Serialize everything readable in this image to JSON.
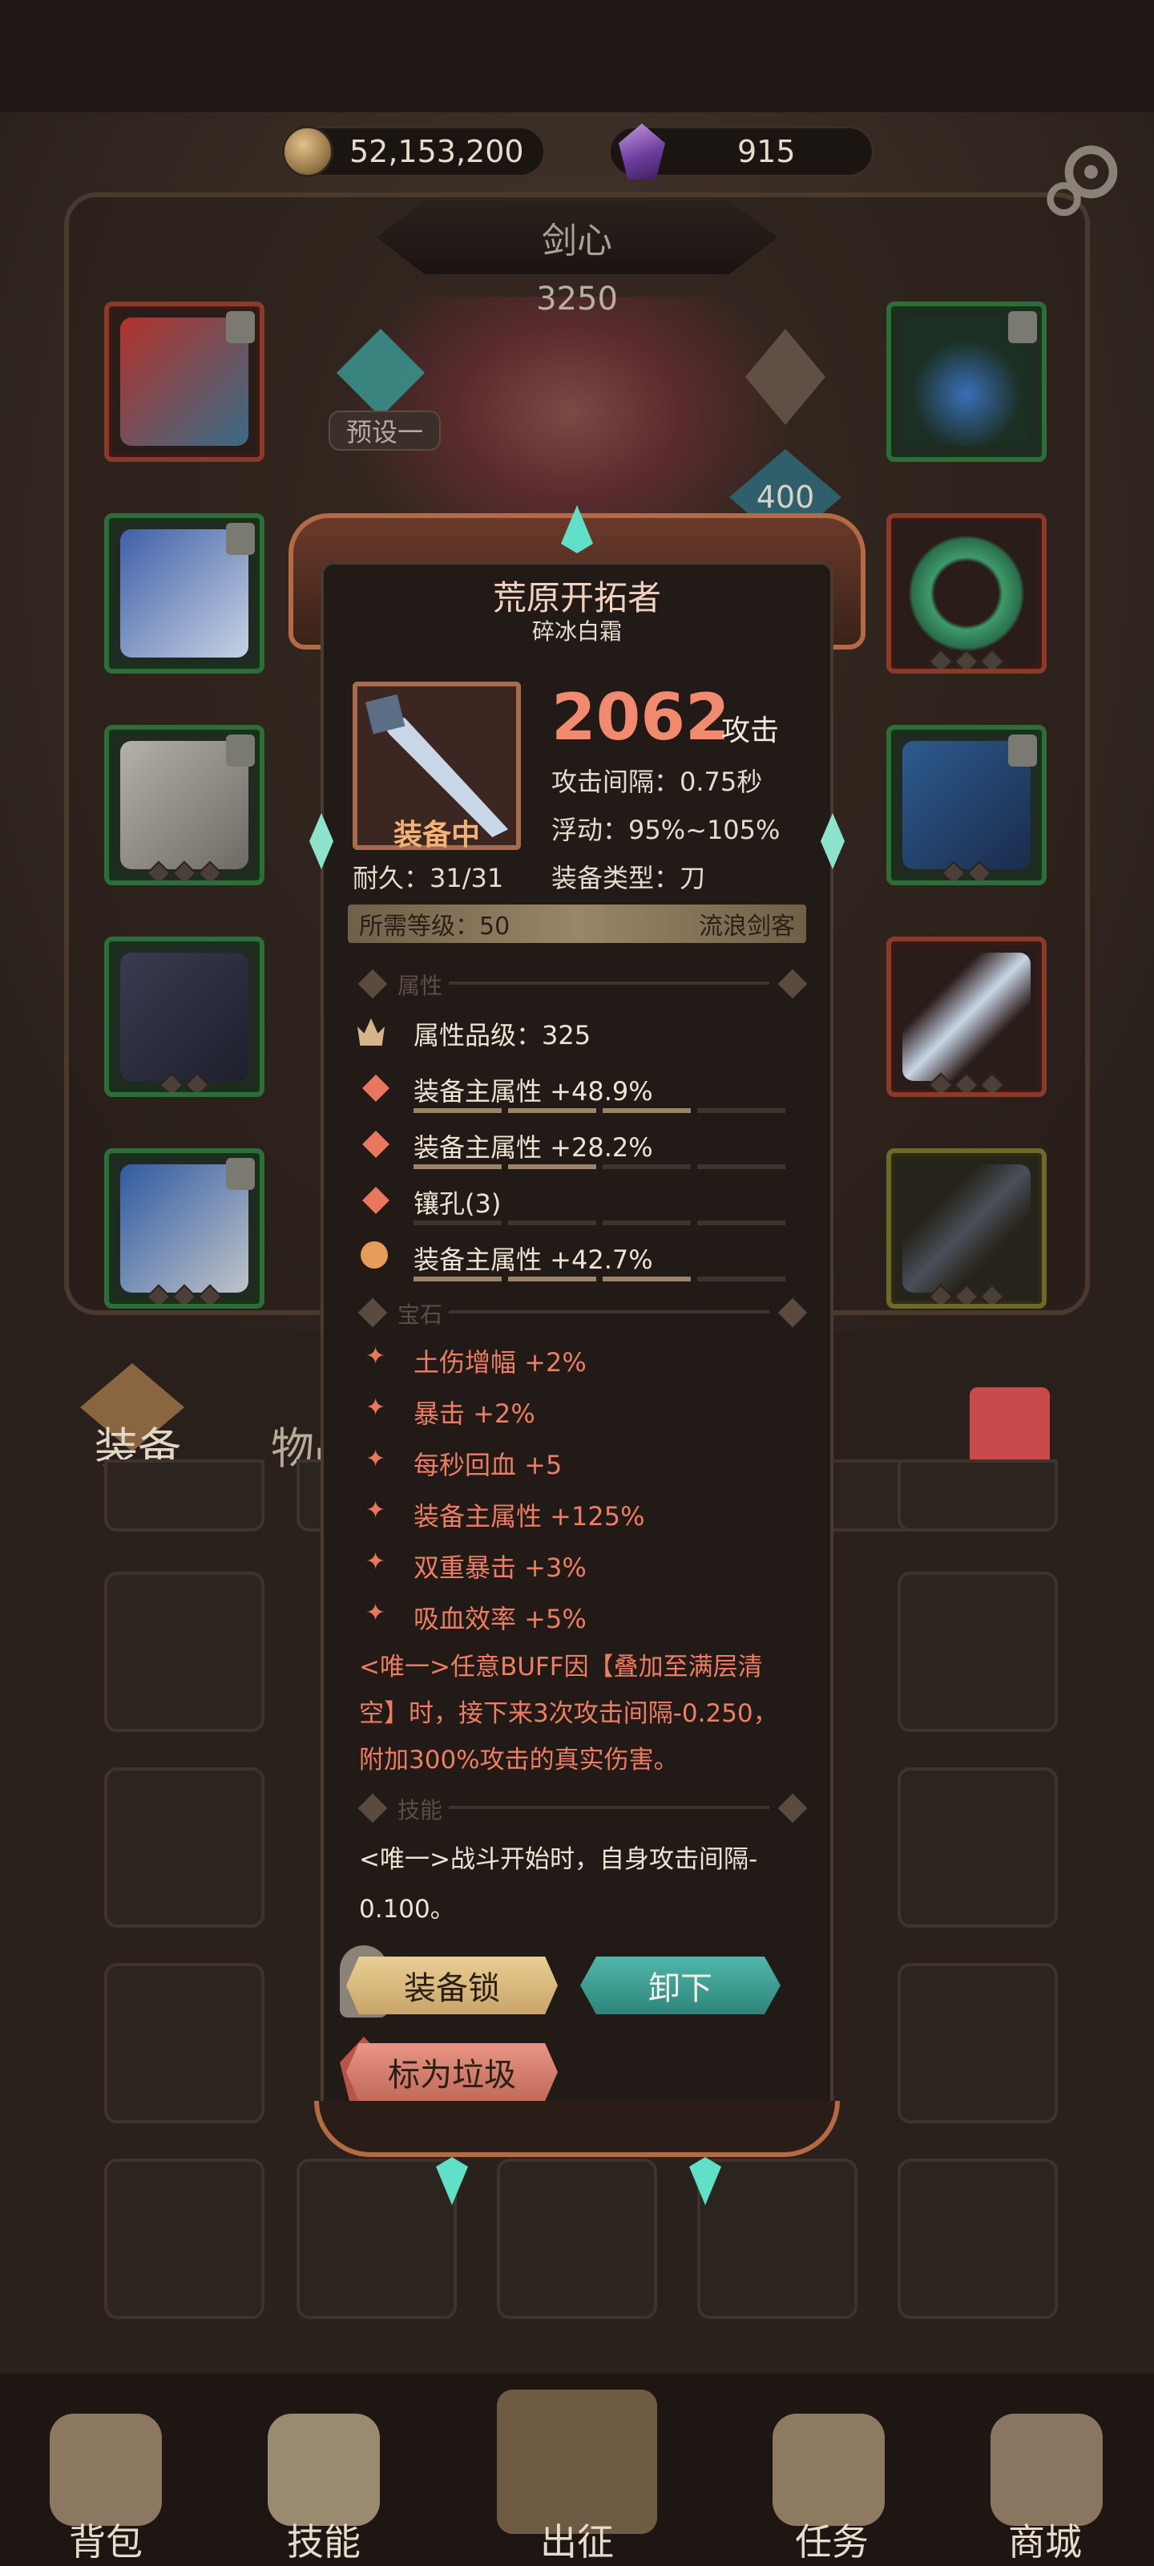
{
  "currency": {
    "gold": "52,153,200",
    "gems": "915",
    "gold_icon": "coin-icon",
    "gem_icon": "purple-gem-icon"
  },
  "settings_icon": "gear-icon",
  "hero": {
    "name": "剑心",
    "score": "3250",
    "preset_label": "预设一",
    "level": "400"
  },
  "item": {
    "name": "荒原开拓者",
    "subtitle": "碎冰白霜",
    "status": "装备中",
    "attack_value": "2062",
    "attack_suffix": "攻击",
    "attack_interval": "攻击间隔：0.75秒",
    "float": "浮动：95%~105%",
    "durability": "耐久：31/31",
    "type": "装备类型：刀",
    "required_level": "所需等级：50",
    "class": "流浪剑客"
  },
  "sections": {
    "attributes": "属性",
    "gems": "宝石",
    "skills": "技能"
  },
  "attributes": [
    {
      "icon": "crown-icon",
      "text": "属性品级：325"
    },
    {
      "icon": "diamond-icon",
      "text": "装备主属性 +48.9%",
      "progress": 0.7
    },
    {
      "icon": "diamond-icon",
      "text": "装备主属性 +28.2%",
      "progress": 0.45
    },
    {
      "icon": "diamond-icon",
      "text": "镶孔(3)",
      "progress": 0.0
    },
    {
      "icon": "cycle-icon",
      "text": "装备主属性 +42.7%",
      "progress": 0.6
    }
  ],
  "gems": [
    "土伤增幅 +2%",
    "暴击 +2%",
    "每秒回血 +5",
    "装备主属性 +125%",
    "双重暴击 +3%",
    "吸血效率 +5%"
  ],
  "unique_desc": {
    "line1": "<唯一>任意BUFF因【叠加至满层清",
    "line2": "空】时，接下来3次攻击间隔-0.250，",
    "line3": "附加300%攻击的真实伤害。"
  },
  "skill_desc": {
    "line1": "<唯一>战斗开始时，自身攻击间隔-",
    "line2": "0.100。"
  },
  "buttons": {
    "lock": "装备锁",
    "unequip": "卸下",
    "mark_trash": "标为垃圾"
  },
  "tabs": {
    "equipment": "装备",
    "items": "物品"
  },
  "bottom_nav": [
    {
      "label": "背包",
      "icon": "backpack-icon"
    },
    {
      "label": "技能",
      "icon": "skill-book-icon"
    },
    {
      "label": "出征",
      "icon": "sword-icon"
    },
    {
      "label": "任务",
      "icon": "scroll-icon"
    },
    {
      "label": "商城",
      "icon": "shop-icon"
    }
  ],
  "colors": {
    "accent_red": "#f28a6f",
    "accent_teal": "#4fb6a9",
    "frame_bronze": "#b56a43",
    "gem_text": "#ef7c64"
  }
}
